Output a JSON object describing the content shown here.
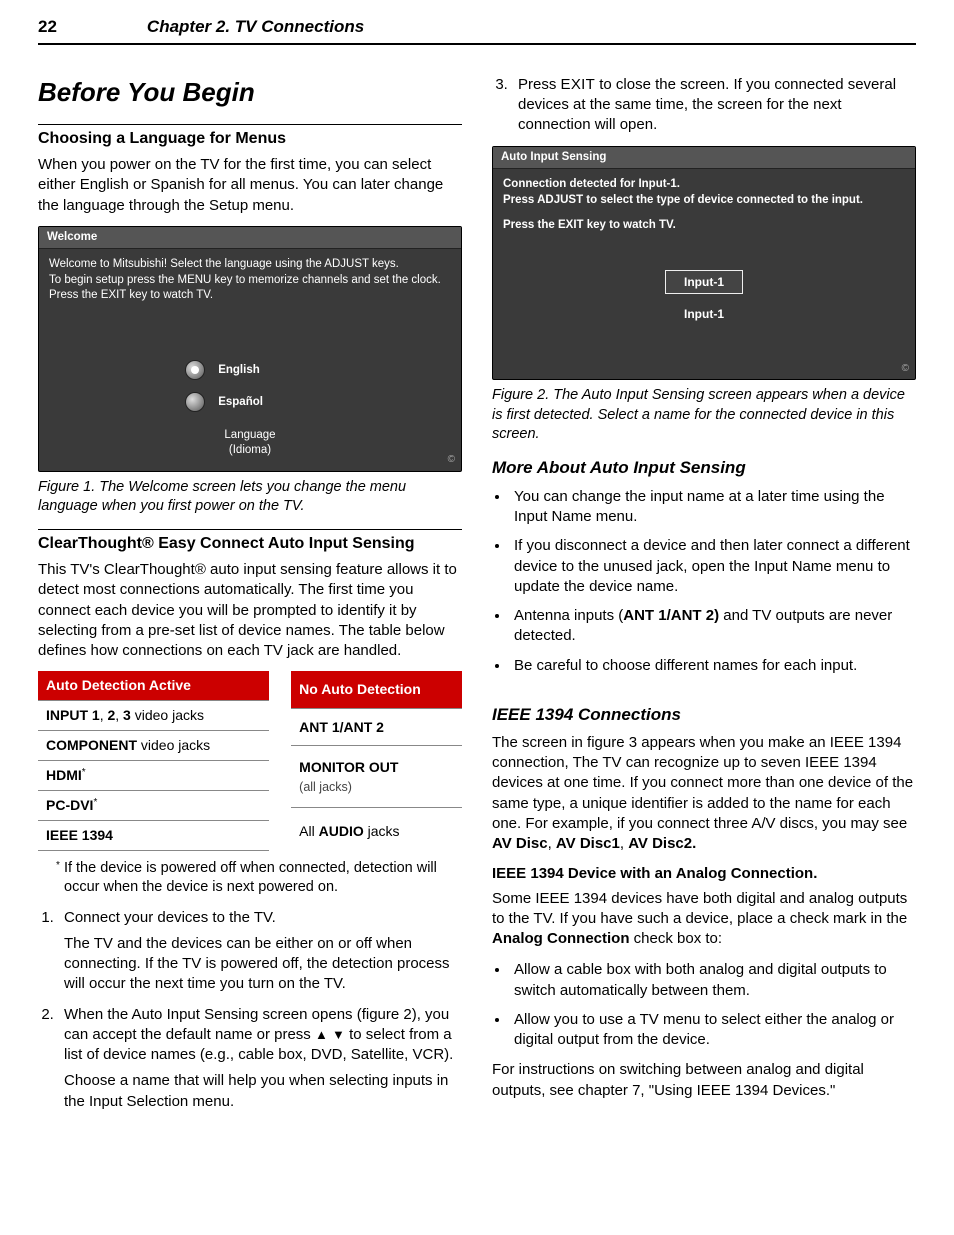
{
  "header": {
    "page": "22",
    "chapter": "Chapter 2. TV Connections"
  },
  "left": {
    "h1": "Before You Begin",
    "sec1": {
      "title": "Choosing a Language for Menus",
      "body": "When you power on the TV for the first time, you can select either English or Spanish for all menus.  You can later change the language through the Setup menu."
    },
    "fig1": {
      "title": "Welcome",
      "line1": "Welcome to Mitsubishi!  Select the language using the ADJUST keys.",
      "line2": "To begin setup press the MENU key to memorize channels and set the clock.",
      "line3": "Press the EXIT key to watch TV.",
      "opt1": "English",
      "opt2": "Español",
      "caption": "Language",
      "caption2": "(Idioma)",
      "figcap": "Figure 1.  The Welcome screen lets you change the menu language when you first power on the TV."
    },
    "sec2": {
      "title": "ClearThought® Easy Connect Auto Input Sensing",
      "body": "This TV's ClearThought® auto input sensing feature allows it to detect most connections automatically.  The first time you connect each device you will be prompted to identify it by selecting from a pre-set list of device names.  The table below defines how connections on each TV jack are handled."
    },
    "tableA": {
      "head": "Auto Detection Active",
      "r1a": "INPUT 1",
      "r1b": ", ",
      "r1c": "2",
      "r1d": ", ",
      "r1e": "3",
      "r1f": " video jacks",
      "r2a": "COMPONENT",
      "r2b": " video jacks",
      "r3": "HDMI",
      "r4": "PC-DVI",
      "r5": "IEEE 1394"
    },
    "tableB": {
      "head": "No Auto Detection",
      "r1": "ANT 1/ANT 2",
      "r2a": "MONITOR OUT",
      "r2b": "(all jacks)",
      "r3a": "All ",
      "r3b": "AUDIO",
      "r3c": " jacks"
    },
    "tablenote": "If the device is powered off when connected, detection will occur when the device is next powered on.",
    "ol": {
      "i1a": "Connect your devices to the TV.",
      "i1b": "The TV and the devices can be either on or off when connecting.  If the TV is powered off, the detection process will occur the next time you turn on the TV.",
      "i2a": "When the Auto Input Sensing screen opens (figure 2), you can accept the default name or press ",
      "i2b": " to select from a list of device names (e.g., cable box, DVD, Satellite, VCR).",
      "i2c": "Choose a name that will help you when selecting inputs in the Input Selection menu."
    }
  },
  "right": {
    "ol3a": "Press ",
    "ol3exit": "EXIT",
    "ol3b": " to close the screen.  If you connected several devices at the same time, the screen for the next connection will open.",
    "fig2": {
      "title": "Auto Input Sensing",
      "line1": "Connection detected for Input-1.",
      "line2": "Press ADJUST to select the type of device connected to the input.",
      "line3": "Press the EXIT key to watch TV.",
      "boxed": "Input-1",
      "plain": "Input-1",
      "figcap": "Figure 2.  The Auto Input Sensing screen appears when a device is first detected.  Select a name for the connected device in this screen."
    },
    "more": {
      "title": "More About Auto Input Sensing",
      "b1": "You can change the input name at a later time using the Input Name menu.",
      "b2": "If you disconnect a device and then later connect a different device to the unused jack, open the Input Name menu to update the device name.",
      "b3a": "Antenna inputs (",
      "b3b": "ANT 1/ANT 2)",
      "b3c": " and TV outputs are never detected.",
      "b4": "Be careful to choose different names for each input."
    },
    "ieee": {
      "title": "IEEE 1394 Connections",
      "p1a": "The screen in figure 3 appears when you make an IEEE 1394 connection,  The TV can recognize up to seven IEEE 1394 devices at one time.  If you connect more than one device of the same type, a unique identifier is added to the name for each one.  For example, if you connect three A/V discs, you may see ",
      "p1b": "AV Disc",
      "p1c": ", ",
      "p1d": "AV Disc1",
      "p1e": ", ",
      "p1f": "AV Disc2.",
      "subhead": "IEEE 1394 Device with an Analog Connection.",
      "p2a": "Some IEEE 1394 devices have both digital and analog outputs to the TV.  If you have such a device, place a check mark in the ",
      "p2b": "Analog Connection",
      "p2c": " check box to:",
      "b1": "Allow a cable box with both analog and digital outputs to switch automatically between them.",
      "b2": "Allow you to use a TV menu to select either the analog or digital output from the device.",
      "p3": "For instructions on switching between analog and digital outputs, see chapter 7, \"Using IEEE 1394 Devices.\""
    }
  }
}
